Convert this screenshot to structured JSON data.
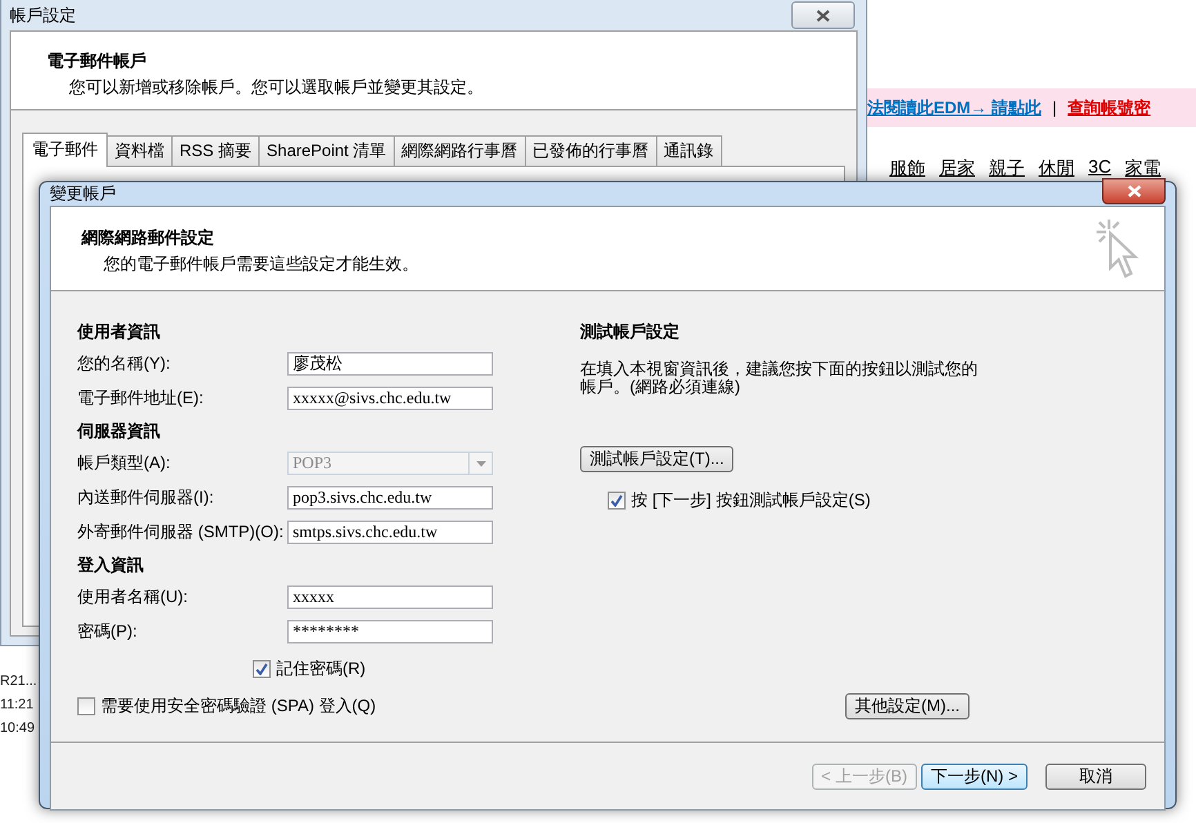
{
  "background_window": {
    "title": "帳戶設定",
    "heading": "電子郵件帳戶",
    "subtitle": "您可以新增或移除帳戶。您可以選取帳戶並變更其設定。",
    "tabs": [
      {
        "label": "電子郵件",
        "selected": true
      },
      {
        "label": "資料檔",
        "selected": false
      },
      {
        "label": "RSS 摘要",
        "selected": false
      },
      {
        "label": "SharePoint 清單",
        "selected": false
      },
      {
        "label": "網際網路行事曆",
        "selected": false
      },
      {
        "label": "已發佈的行事曆",
        "selected": false
      },
      {
        "label": "通訊錄",
        "selected": false
      }
    ]
  },
  "mail_list": [
    "R21...",
    "11:21",
    "10:49"
  ],
  "web_page": {
    "banner_link": "法閱讀此EDM→ 請點此",
    "separator": "|",
    "account_link": "查詢帳號密",
    "nav": [
      "服飾",
      "居家",
      "親子",
      "休閒",
      "3C",
      "家電"
    ]
  },
  "dialog": {
    "title": "變更帳戶",
    "heading": "網際網路郵件設定",
    "subtitle": "您的電子郵件帳戶需要這些設定才能生效。",
    "sections": [
      {
        "title": "使用者資訊",
        "fields": [
          {
            "label": "您的名稱(Y):",
            "value": "廖茂松",
            "kind": "text",
            "disabled": false
          },
          {
            "label": "電子郵件地址(E):",
            "value": "xxxxx@sivs.chc.edu.tw",
            "kind": "text",
            "disabled": false
          }
        ]
      },
      {
        "title": "伺服器資訊",
        "fields": [
          {
            "label": "帳戶類型(A):",
            "value": "POP3",
            "kind": "dropdown",
            "disabled": true
          },
          {
            "label": "內送郵件伺服器(I):",
            "value": "pop3.sivs.chc.edu.tw",
            "kind": "text",
            "disabled": false
          },
          {
            "label": "外寄郵件伺服器 (SMTP)(O):",
            "value": "smtps.sivs.chc.edu.tw",
            "kind": "text",
            "disabled": false
          }
        ]
      },
      {
        "title": "登入資訊",
        "fields": [
          {
            "label": "使用者名稱(U):",
            "value": "xxxxx",
            "kind": "text",
            "disabled": false
          },
          {
            "label": "密碼(P):",
            "value": "********",
            "kind": "text",
            "disabled": false
          }
        ]
      }
    ],
    "remember_password": {
      "label": "記住密碼(R)",
      "checked": true
    },
    "spa": {
      "label": "需要使用安全密碼驗證 (SPA) 登入(Q)",
      "checked": false
    },
    "test": {
      "title": "測試帳戶設定",
      "text": "在填入本視窗資訊後，建議您按下面的按鈕以測試您的帳戶。(網路必須連線)",
      "button": "測試帳戶設定(T)...",
      "auto_test": {
        "label": "按 [下一步] 按鈕測試帳戶設定(S)",
        "checked": true
      }
    },
    "more_button": "其他設定(M)...",
    "footer_buttons": [
      {
        "label": "< 上一步(B)",
        "disabled": true,
        "default": false
      },
      {
        "label": "下一步(N) >",
        "disabled": false,
        "default": true
      },
      {
        "label": "取消",
        "disabled": false,
        "default": false
      }
    ]
  }
}
